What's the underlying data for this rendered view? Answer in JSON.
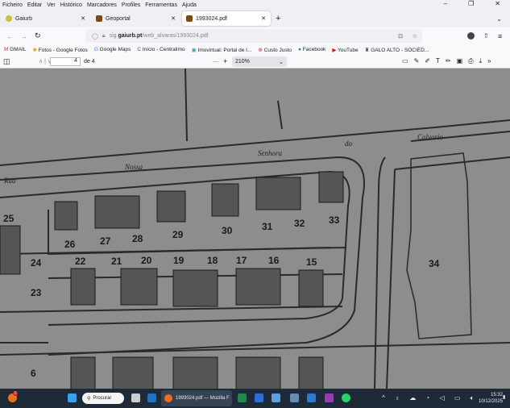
{
  "menu": [
    "Ficheiro",
    "Editar",
    "Ver",
    "Histórico",
    "Marcadores",
    "Profiles",
    "Ferramentas",
    "Ajuda"
  ],
  "window_controls": {
    "minimize": "–",
    "restore": "❐",
    "close": "✕"
  },
  "tabs": [
    {
      "title": "Gaiurb",
      "color": "#c9c23a"
    },
    {
      "title": "Geoportal",
      "color": "#7a4a10"
    },
    {
      "title": "1993024.pdf",
      "color": "#7a4a10",
      "active": true
    }
  ],
  "new_tab": "+",
  "url": {
    "prefix": "sig.",
    "domain": "gaiurb.pt",
    "path": "/web_alvaras/1993024.pdf"
  },
  "bookmarks": [
    "GMAIL",
    "Fotos - Google Fotos",
    "Google Maps",
    "Início - Centralimo",
    "Imovirtual: Portal de I...",
    "Custo Justo",
    "Facebook",
    "YouTube",
    "GALO ALTO - SOCIED..."
  ],
  "pdf": {
    "page": "4",
    "of": "de 4",
    "zoom": "210%"
  },
  "map": {
    "lots_top": [
      "25",
      "26",
      "27",
      "28",
      "29",
      "30",
      "31",
      "32",
      "33"
    ],
    "lots_mid": [
      "24",
      "22",
      "21",
      "20",
      "19",
      "18",
      "17",
      "16",
      "15"
    ],
    "lots_other": [
      "23",
      "34",
      "6"
    ],
    "street": [
      "Rua",
      "Nossa",
      "Senhora",
      "do",
      "Calvario"
    ]
  },
  "taskbar": {
    "search": "Procurar",
    "firefox": "1993024.pdf — Mozilla F",
    "time": "15:32",
    "date": "10/12/2025",
    "badge": "1"
  }
}
